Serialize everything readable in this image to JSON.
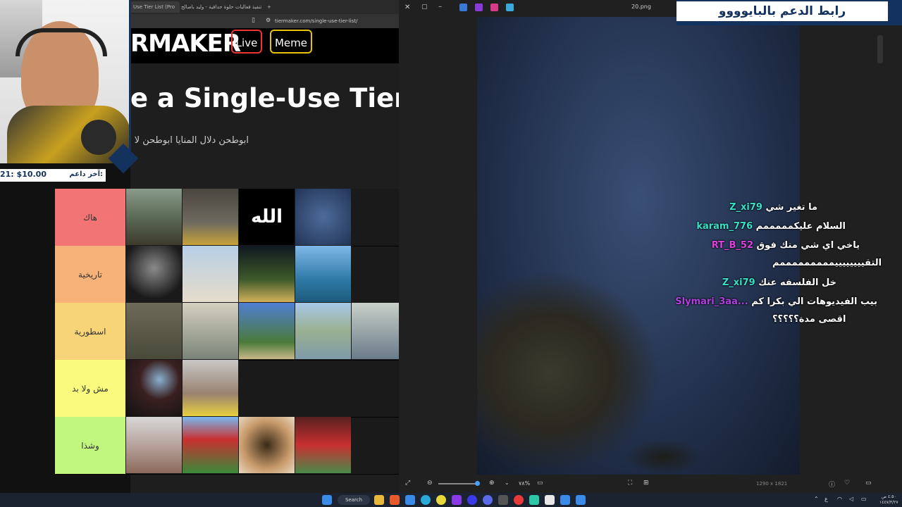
{
  "browser": {
    "tabs": [
      {
        "label": "Use Tier List (Pro"
      },
      {
        "label": "تنفيذ فعاليات حلوة جدافية - وليد باصالح"
      }
    ],
    "url": "tiermaker.com/single-use-tier-list/",
    "logo": "RMAKER",
    "nav": {
      "live": "Live",
      "meme": "Meme"
    },
    "page_title": "e a Single-Use Tier L",
    "page_desc": "ابوطحن دلال المنايا ابوطحن لا"
  },
  "tiers": [
    {
      "label": "هاك",
      "color": "#f27474"
    },
    {
      "label": "تاريخية",
      "color": "#f7b27a"
    },
    {
      "label": "اسطورية",
      "color": "#f7d477"
    },
    {
      "label": "مش ولا بد",
      "color": "#fafa7f"
    },
    {
      "label": "وشذا",
      "color": "#c2f77f"
    }
  ],
  "tier_image_text": "الله",
  "donor": {
    "amount": "21: $10.00",
    "label": "آخر داعم:"
  },
  "banner": {
    "text": "رابط الدعم بالبايوووو"
  },
  "viewer": {
    "filename": "20.png",
    "zoom": "٧٨%",
    "dims": "1290 x 1821"
  },
  "chat": [
    {
      "user": "Z_xi79",
      "msg": "ما تغير شي",
      "color": "#38e0c8"
    },
    {
      "user": "karam_776",
      "msg": "السلام عليكمممممم",
      "color": "#38e0c8"
    },
    {
      "user": "RT_B_52",
      "msg": "ياخي اي شي منك فوق",
      "color": "#e040e0"
    },
    {
      "user": "",
      "msg": "التقييييييييمممممممممم",
      "color": "#ffffff"
    },
    {
      "user": "Z_xi79",
      "msg": "خل الفلسفه عنك",
      "color": "#38e0c8"
    },
    {
      "user": "Slymari_3aa...",
      "msg": "بيب الفيديوهات الي بكرا كم",
      "color": "#b040e0"
    },
    {
      "user": "",
      "msg": "اقصى مدة؟؟؟؟؟",
      "color": "#ffffff"
    }
  ],
  "taskbar": {
    "search": "Search",
    "time": "٤:٥٠ ص",
    "date": "١٤٤٧/٣/٢٧"
  }
}
